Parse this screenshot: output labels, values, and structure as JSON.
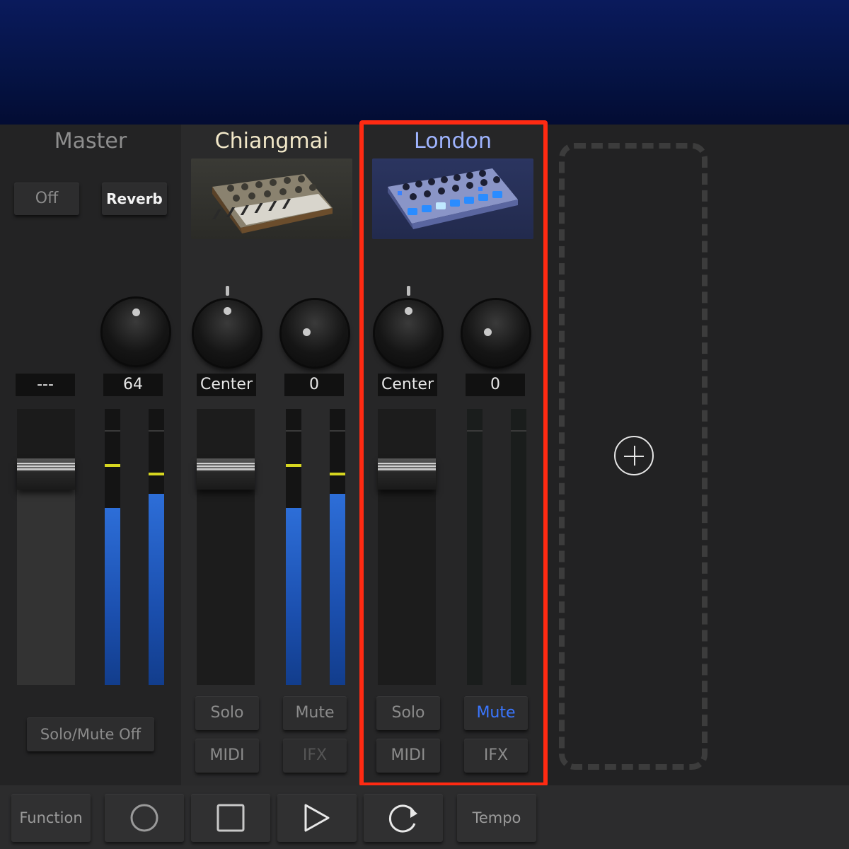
{
  "master": {
    "name": "Master",
    "off_button": "Off",
    "reverb_button": "Reverb",
    "readout_left": "---",
    "readout_right": "64",
    "solo_mute_off": "Solo/Mute Off"
  },
  "chiangmai": {
    "name": "Chiangmai",
    "instrument_icon": "analog-synth-icon",
    "pan_readout": "Center",
    "send_readout": "0",
    "solo": "Solo",
    "mute": "Mute",
    "midi": "MIDI",
    "ifx": "IFX",
    "meter_level": 0.64
  },
  "london": {
    "name": "London",
    "instrument_icon": "drum-machine-icon",
    "pan_readout": "Center",
    "send_readout": "0",
    "solo": "Solo",
    "mute": "Mute",
    "mute_active": true,
    "midi": "MIDI",
    "ifx": "IFX",
    "meter_level": 0
  },
  "master_meter_level": 0.64,
  "add_track_icon": "plus-circle-icon",
  "transport": {
    "function": "Function",
    "record_icon": "record-icon",
    "stop_icon": "stop-icon",
    "play_icon": "play-icon",
    "loop_icon": "loop-icon",
    "tempo": "Tempo"
  },
  "colors": {
    "highlight": "#ff2a12",
    "mute_active": "#3a76ff",
    "meter_blue": "#2d6ed8",
    "peak_yellow": "#d6d620"
  }
}
